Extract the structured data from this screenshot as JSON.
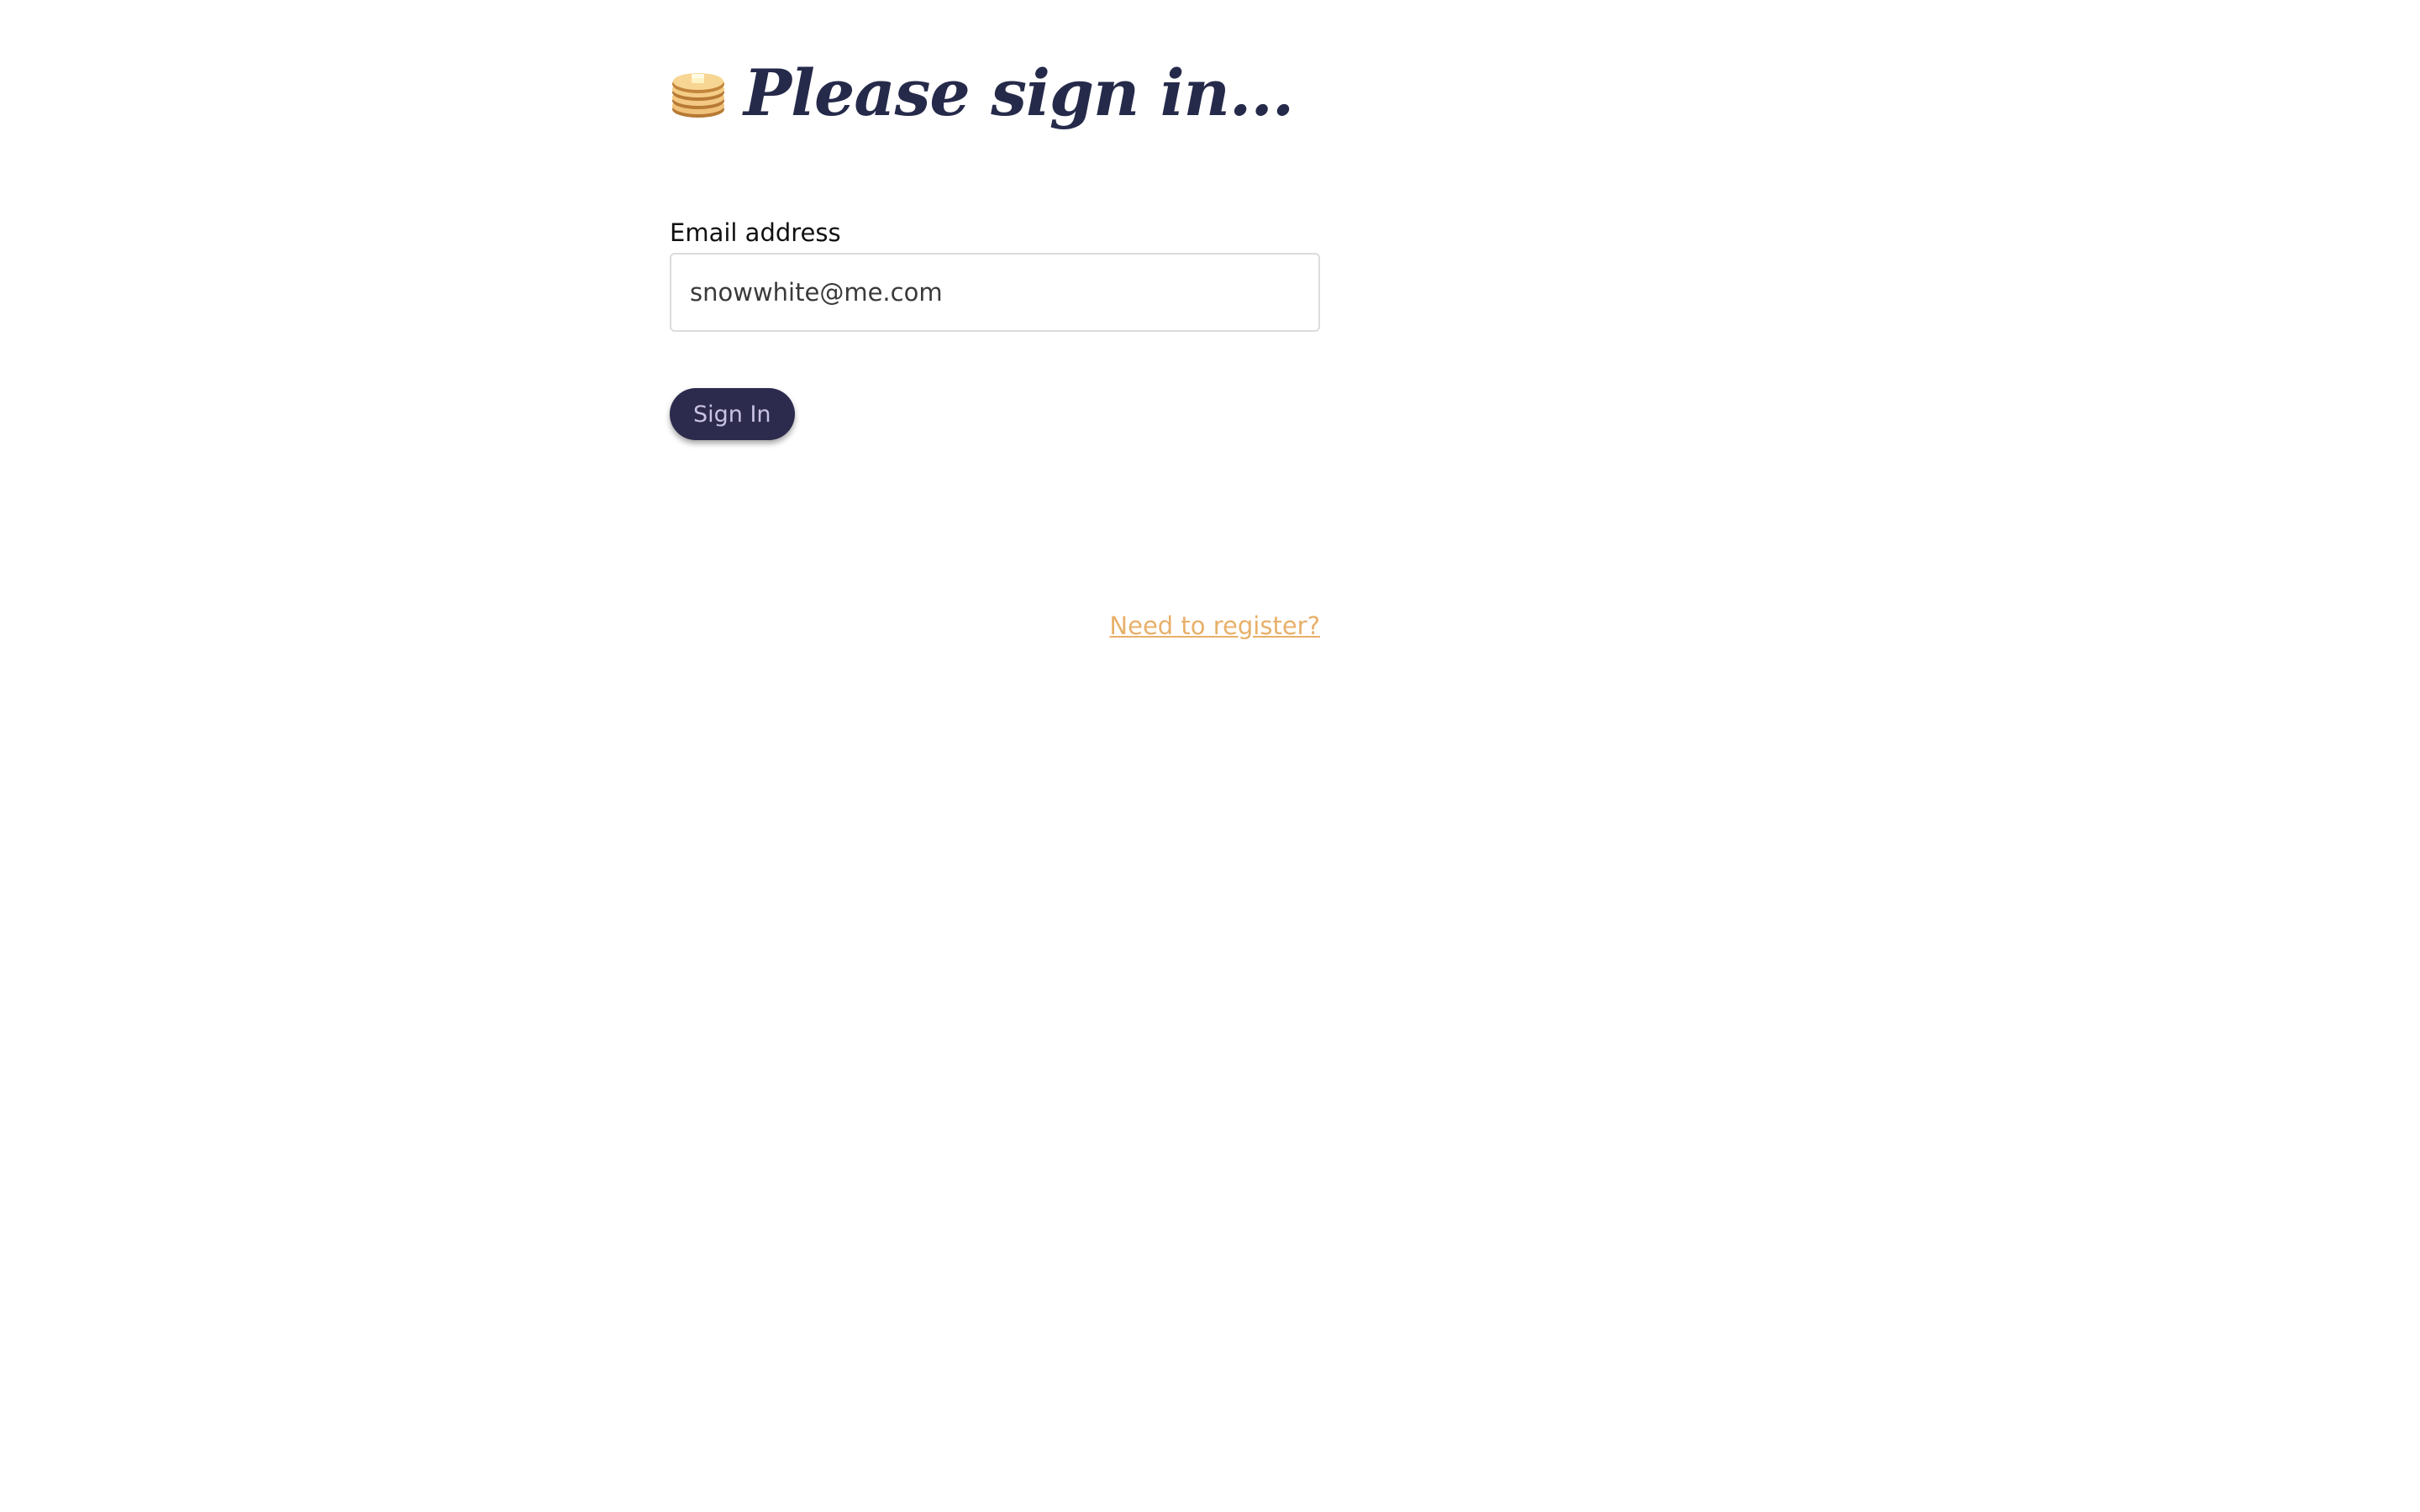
{
  "header": {
    "icon": "pancakes-icon",
    "title": "Please sign in..."
  },
  "form": {
    "email_label": "Email address",
    "email_value": "snowwhite@me.com",
    "submit_label": "Sign In"
  },
  "footer": {
    "register_link": "Need to register?"
  },
  "colors": {
    "title": "#262a4a",
    "button_bg": "#2d2b4d",
    "button_text": "#c9c2e2",
    "link": "#e8b06a",
    "input_border": "#dcdcdc"
  }
}
